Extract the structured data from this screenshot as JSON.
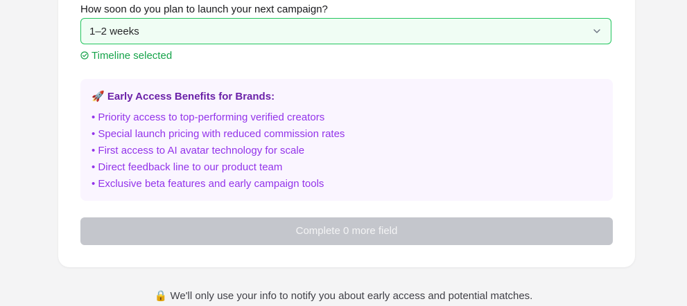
{
  "form": {
    "question_label": "How soon do you plan to launch your next campaign?",
    "timeline_select": {
      "value": "1–2 weeks",
      "icon": "chevron-down-icon"
    },
    "status": {
      "text": "Timeline selected",
      "icon": "check-circle-icon",
      "color": "#16a34a"
    },
    "benefits": {
      "emoji": "🚀",
      "title": "Early Access Benefits for Brands:",
      "items": [
        "• Priority access to top-performing verified creators",
        "• Special launch pricing with reduced commission rates",
        "• First access to AI avatar technology for scale",
        "• Direct feedback line to our product team",
        "• Exclusive beta features and early campaign tools"
      ]
    },
    "submit_label": "Complete 0 more field"
  },
  "footer": {
    "text": "🔒 We'll only use your info to notify you about early access and potential matches."
  },
  "colors": {
    "accent_green": "#22c55e",
    "select_bg": "#f0fdf4",
    "benefits_bg": "#faf5ff",
    "benefits_title": "#6b21a8",
    "benefits_text": "#9333ea",
    "disabled_button": "#c4c6cc"
  }
}
